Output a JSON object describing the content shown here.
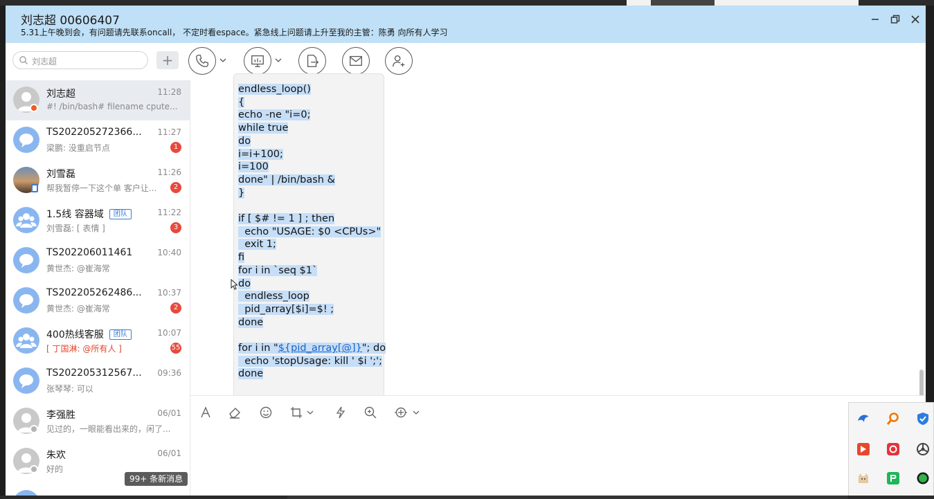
{
  "window": {
    "title": "刘志超 00606407",
    "notice": "5.31上午晚到会，有问题请先联系oncall， 不定时看espace。紧急线上问题请上升至我的主管：陈勇   向所有人学习"
  },
  "search": {
    "placeholder": "刘志超"
  },
  "conversations": [
    {
      "name": "刘志超",
      "time": "11:28",
      "preview": "#! /bin/bash# filename cpute...",
      "badge": ""
    },
    {
      "name": "TS202205272366...",
      "time": "11:27",
      "preview": "梁鹏: 没重启节点",
      "badge": "1"
    },
    {
      "name": "刘雪磊",
      "time": "11:26",
      "preview": "帮我暂停一下这个单 客户让...",
      "badge": "2"
    },
    {
      "name": "1.5线 容器域",
      "tag": "团队",
      "time": "11:22",
      "preview": "刘雪磊: [ 表情 ]",
      "badge": "3"
    },
    {
      "name": "TS202206011461",
      "time": "10:40",
      "preview": "黄世杰: @崔海常",
      "badge": ""
    },
    {
      "name": "TS202205262486...",
      "time": "10:37",
      "preview": "黄世杰: @崔海常",
      "badge": "2"
    },
    {
      "name": "400热线客服",
      "tag": "团队",
      "time": "10:07",
      "preview": "[ 丁国淋: @所有人 ]",
      "badge": "55"
    },
    {
      "name": "TS202205312567...",
      "time": "09:36",
      "preview": "张琴琴: 可以",
      "badge": ""
    },
    {
      "name": "李强胜",
      "time": "06/01",
      "preview": "见过的，一眼能看出来的，闲了...",
      "badge": ""
    },
    {
      "name": "朱欢",
      "time": "06/01",
      "preview": "好的",
      "badge": ""
    }
  ],
  "new_messages": "99+ 条新消息",
  "code_lines": [
    "endless_loop()",
    "{",
    "echo -ne \"i=0;",
    "while true",
    "do",
    "i=i+100;",
    "i=100",
    "done\" | /bin/bash &",
    "}",
    "",
    "if [ $# != 1 ] ; then",
    "  echo \"USAGE: $0 <CPUs>\"",
    "  exit 1;",
    "fi",
    "for i in `seq $1`",
    "do",
    "  endless_loop",
    "  pid_array[$i]=$! ;",
    "done",
    "",
    "for i in \"",
    "  echo 'stopUsage: kill ' $i ';';",
    "done"
  ],
  "code_link": "${pid_array[@]}",
  "code_after_link": "\"; do",
  "colors": {
    "header_bg": "#bfe0f7",
    "selection": "#c6def7",
    "badge": "#e8493c",
    "accent": "#3a7bd5"
  }
}
